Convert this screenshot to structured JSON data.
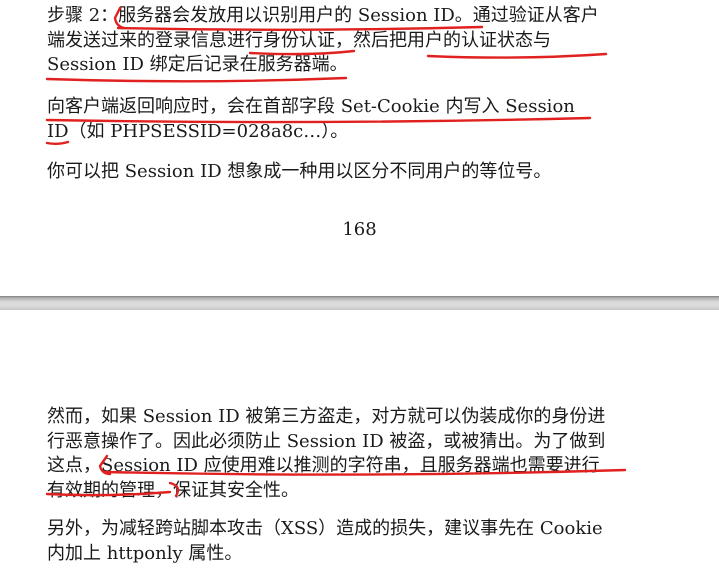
{
  "top_page": {
    "para1": {
      "line1": "步骤 2：服务器会发放用以识别用户的 Session ID。通过验证从客户",
      "line2": "端发送过来的登录信息进行身份认证，然后把用户的认证状态与",
      "line3": "Session ID 绑定后记录在服务器端。"
    },
    "para2": {
      "line1": "向客户端返回响应时，会在首部字段 Set-Cookie 内写入 Session",
      "line2": "ID（如 PHPSESSID=028a8c…）。"
    },
    "para3": {
      "line1": "你可以把 Session ID 想象成一种用以区分不同用户的等位号。"
    },
    "page_number": "168"
  },
  "bottom_page": {
    "para1": {
      "line1": "然而，如果 Session ID 被第三方盗走，对方就可以伪装成你的身份进",
      "line2": "行恶意操作了。因此必须防止 Session ID 被盗，或被猜出。为了做到",
      "line3": "这点，Session ID 应使用难以推测的字符串，且服务器端也需要进行",
      "line4": "有效期的管理，保证其安全性。"
    },
    "para2": {
      "line1": "另外，为减轻跨站脚本攻击（XSS）造成的损失，建议事先在 Cookie",
      "line2": "内加上 httponly 属性。"
    }
  },
  "annotation_color": "#e0211f"
}
